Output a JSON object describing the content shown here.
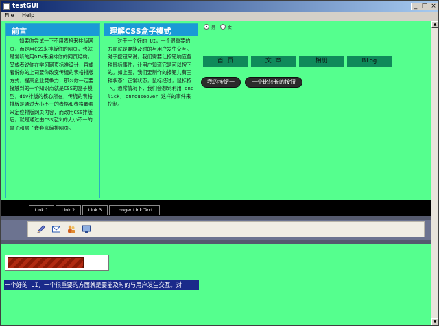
{
  "window": {
    "title": "testGUI",
    "buttons": {
      "minimize": "_",
      "maximize": "□",
      "close": "×"
    }
  },
  "menu": {
    "items": [
      "File",
      "Help"
    ]
  },
  "left_panel": {
    "heading": "前言",
    "body": "如果你尝试一下不用表格来排版网页，而是用CSS来排版你的网页，也就是常听的用DIV来编排你的网页结构，又或者说你在学习网页标准设计，再或者说你的上司要你改变传统的表格排版方式，提高企业竞争力，那么你一定要接触到的一个知识点就是CSS的盒子模型，div排版的核心所在，传统的表格排版是通过大小不一的表格和表格嵌套来定位排版网页内容，而改用CSS排版后，就是通过由CSS定义的大小不一的盒子和盒子嵌套来编排网页。"
  },
  "mid_panel": {
    "heading": "理解CSS盒子模式",
    "body": "对于一个好的 UI，一个很重要的方面就是要能及时的与用户发生交互。对于按钮来说，我们需要让按钮响应各种鼠标事件，让用户知道它是可以按下的。如上图，我们要制作的按钮共有三种状态：正常状态，鼠标经过，鼠标按下。通常情况下，我们会想到利用 onclick, onmouseover 这样的事件来控制。"
  },
  "radio_group": {
    "selected_index": 0,
    "labels": [
      "男",
      "女"
    ]
  },
  "nav": {
    "items": [
      "首 页",
      "文 章",
      "相册",
      "Blog"
    ]
  },
  "buttons": {
    "my_button": "我的按钮一",
    "long_button": "一个比较长的按钮"
  },
  "tabs": [
    "Link 1",
    "Link 2",
    "Link 3",
    "Longer Link Text"
  ],
  "toolbar_icons": [
    "pencil-icon",
    "mail-icon",
    "users-icon",
    "monitor-icon"
  ],
  "progress": {
    "fraction": 0.77
  },
  "marquee": {
    "text": "一个好的 UI，一个很重要的方面就是要能及时的与用户发生交互。对"
  },
  "colors": {
    "background": "#55ff8e",
    "panel_header": "#1a9ad6",
    "nav_item": "#0f8a5a",
    "title_bar": "#0a246a"
  }
}
